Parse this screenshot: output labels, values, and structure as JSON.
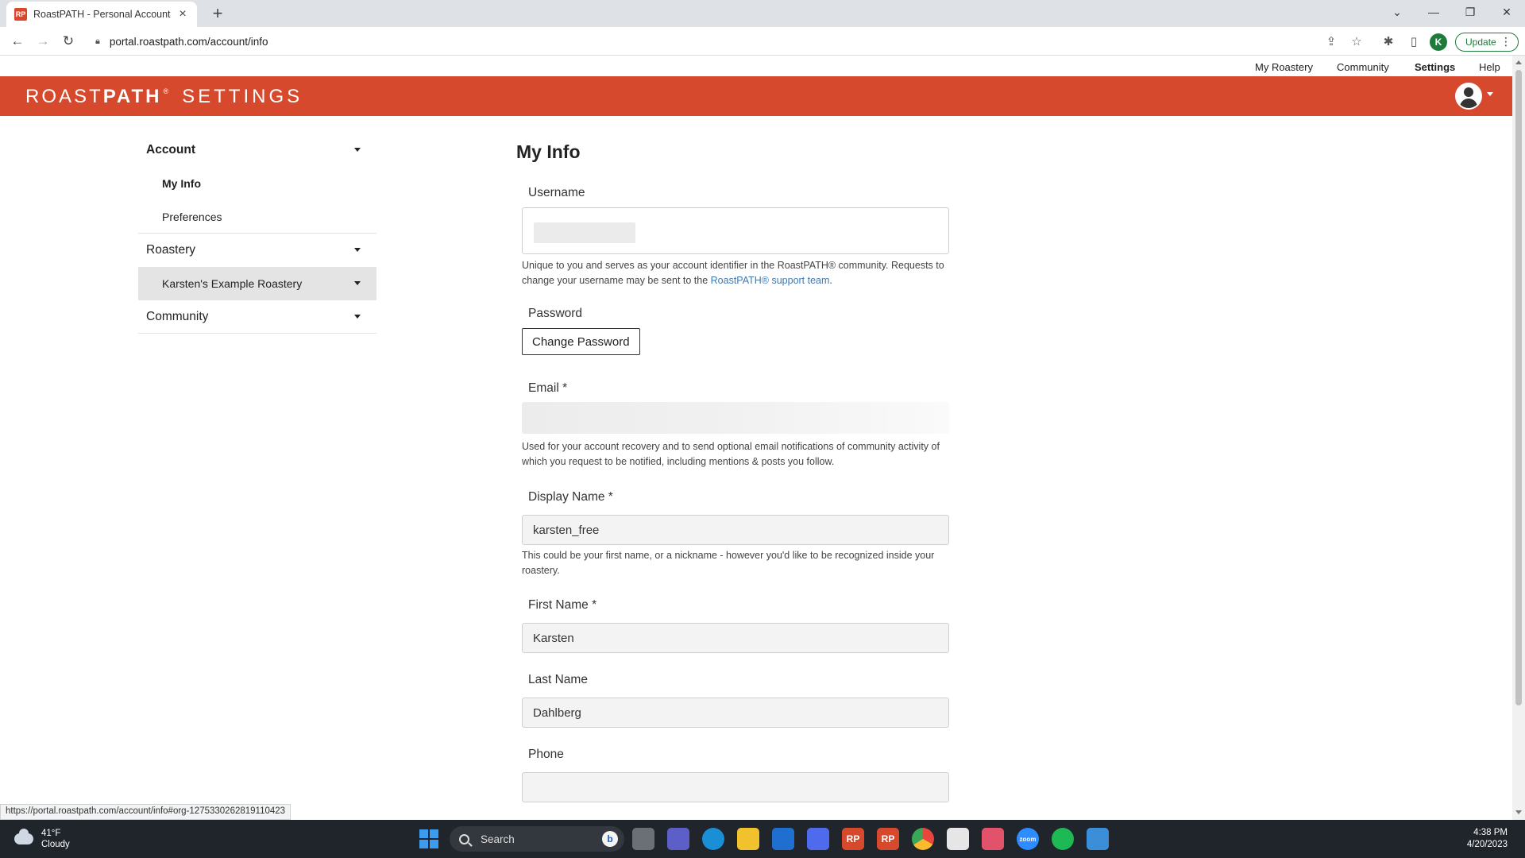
{
  "browser": {
    "tab_title": "RoastPATH - Personal Account",
    "tab_favicon_text": "RP",
    "url": "portal.roastpath.com/account/info",
    "profile_initial": "K",
    "update_label": "Update",
    "status_url": "https://portal.roastpath.com/account/info#org-1275330262819110423"
  },
  "topnav": {
    "my_roastery": "My Roastery",
    "community": "Community",
    "settings": "Settings",
    "help": "Help"
  },
  "brand": {
    "roast": "ROAST",
    "path": "PATH",
    "reg": "®",
    "settings": "SETTINGS"
  },
  "sidebar": {
    "account": "Account",
    "my_info": "My Info",
    "preferences": "Preferences",
    "roastery": "Roastery",
    "roastery_item": "Karsten's Example Roastery",
    "community": "Community"
  },
  "form": {
    "title": "My Info",
    "username_label": "Username",
    "username_help_1": "Unique to you and serves as your account identifier in the RoastPATH® community. Requests to change your username may be sent to the ",
    "username_help_link": "RoastPATH® support team",
    "username_help_2": ".",
    "password_label": "Password",
    "change_password": "Change Password",
    "email_label": "Email *",
    "email_help": "Used for your account recovery and to send optional email notifications of community activity of which you request to be notified, including mentions & posts you follow.",
    "display_name_label": "Display Name *",
    "display_name_value": "karsten_free",
    "display_name_help": "This could be your first name, or a nickname - however you'd like to be recognized inside your roastery.",
    "first_name_label": "First Name *",
    "first_name_value": "Karsten",
    "last_name_label": "Last Name",
    "last_name_value": "Dahlberg",
    "phone_label": "Phone",
    "phone_value": ""
  },
  "taskbar": {
    "temperature": "41°F",
    "condition": "Cloudy",
    "search_label": "Search",
    "bing_letter": "b",
    "time": "4:38 PM",
    "date": "4/20/2023",
    "apps": [
      {
        "name": "file-manager-app",
        "label": "",
        "color": "#6b6f76"
      },
      {
        "name": "teams-app",
        "label": "",
        "color": "#5b5fc7"
      },
      {
        "name": "edge-app",
        "label": "",
        "color": "#1a8fd6"
      },
      {
        "name": "file-explorer-app",
        "label": "",
        "color": "#f2c12e"
      },
      {
        "name": "mail-app",
        "label": "",
        "color": "#1f6fd1"
      },
      {
        "name": "power-automate-app",
        "label": "",
        "color": "#4f6bed"
      },
      {
        "name": "roastpath-app",
        "label": "RP",
        "color": "#d6492d"
      },
      {
        "name": "roastpath-app-2",
        "label": "RP",
        "color": "#d6492d"
      },
      {
        "name": "chrome-app",
        "label": "",
        "color": "#e8453c"
      },
      {
        "name": "slack-app",
        "label": "",
        "color": "#e6e6e6"
      },
      {
        "name": "photos-app",
        "label": "",
        "color": "#e3526b"
      },
      {
        "name": "zoom-app",
        "label": "zoom",
        "color": "#2d8cff"
      },
      {
        "name": "spotify-app",
        "label": "",
        "color": "#1db954"
      },
      {
        "name": "generic-app",
        "label": "",
        "color": "#3a8fd8"
      }
    ]
  }
}
